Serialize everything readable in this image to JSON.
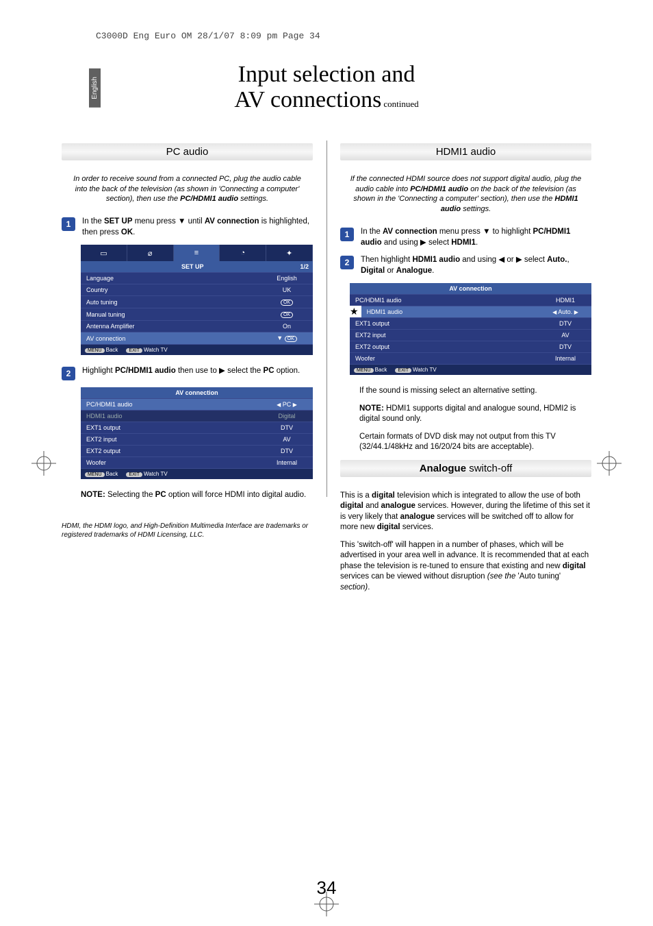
{
  "crop_header": "C3000D Eng Euro OM  28/1/07  8:09 pm  Page 34",
  "lang_tab": "English",
  "title_line1": "Input selection and",
  "title_line2": "AV connections",
  "title_suffix": "continued",
  "pc_audio": {
    "heading": "PC audio",
    "intro_html": "In order to receive sound from a connected PC, plug the audio cable into the back of the television (as shown in 'Connecting a computer' section), then use the <b>PC/HDMI1 audio</b> settings.",
    "step1_html": "In the <b>SET UP</b> menu press ▼ until <b>AV connection</b> is highlighted, then press <b>OK</b>.",
    "step2_html": "Highlight <b>PC/HDMI1 audio</b> then use to ▶ select the <b>PC</b> option.",
    "note_html": "<b>NOTE:</b> Selecting the <b>PC</b> option will force HDMI into digital audio."
  },
  "setup_osd": {
    "title": "SET UP",
    "page": "1/2",
    "rows": [
      {
        "label": "Language",
        "value": "English"
      },
      {
        "label": "Country",
        "value": "UK"
      },
      {
        "label": "Auto tuning",
        "value": "OK"
      },
      {
        "label": "Manual tuning",
        "value": "OK"
      },
      {
        "label": "Antenna Amplifier",
        "value": "On"
      },
      {
        "label": "AV connection",
        "value": "OK"
      }
    ],
    "footer_back": "Back",
    "footer_watch": "Watch TV",
    "menu_pill": "MENU",
    "exit_pill": "EXIT"
  },
  "av_osd_pc": {
    "title": "AV connection",
    "rows": [
      {
        "label": "PC/HDMI1 audio",
        "value": "PC",
        "hi": true,
        "arrows": true
      },
      {
        "label": "HDMI1 audio",
        "value": "Digital",
        "dim": true
      },
      {
        "label": "EXT1 output",
        "value": "DTV"
      },
      {
        "label": "EXT2 input",
        "value": "AV"
      },
      {
        "label": "EXT2 output",
        "value": "DTV"
      },
      {
        "label": "Woofer",
        "value": "Internal"
      }
    ],
    "footer_back": "Back",
    "footer_watch": "Watch TV",
    "menu_pill": "MENU",
    "exit_pill": "EXIT"
  },
  "hdmi_audio": {
    "heading": "HDMI1 audio",
    "intro_html": "If the connected HDMI source does not support digital audio, plug the audio cable into <b>PC/HDMI1 audio</b> on the back of the television (as shown in the 'Connecting a computer' section), then use the <b>HDMI1 audio</b> settings.",
    "step1_html": "In the <b>AV connection</b> menu press ▼ to highlight <b>PC/HDMI1 audio</b> and using ▶ select <b>HDMI1</b>.",
    "step2_html": "Then highlight <b>HDMI1 audio</b> and using ◀ or ▶ select <b>Auto.</b>, <b>Digital</b> or <b>Analogue</b>.",
    "note1": "If the sound is missing select an alternative setting.",
    "note2_html": "<b>NOTE:</b> HDMI1 supports digital and analogue sound, HDMI2 is digital sound only.",
    "note3": "Certain formats of DVD disk may not output from this TV (32/44.1/48kHz and 16/20/24 bits are acceptable)."
  },
  "av_osd_hdmi": {
    "title": "AV connection",
    "rows": [
      {
        "label": "PC/HDMI1 audio",
        "value": "HDMI1"
      },
      {
        "label": "HDMI1 audio",
        "value": "Auto.",
        "hi": true,
        "arrows": true,
        "star": true
      },
      {
        "label": "EXT1 output",
        "value": "DTV"
      },
      {
        "label": "EXT2 input",
        "value": "AV"
      },
      {
        "label": "EXT2 output",
        "value": "DTV"
      },
      {
        "label": "Woofer",
        "value": "Internal"
      }
    ],
    "footer_back": "Back",
    "footer_watch": "Watch TV",
    "menu_pill": "MENU",
    "exit_pill": "EXIT"
  },
  "analogue": {
    "heading_html": "<b>Analogue</b> switch-off",
    "p1_html": "This is a <b>digital</b> television which is integrated to allow the use of both <b>digital</b> and <b>analogue</b> services. However, during the lifetime of this set it is very likely that <b>analogue</b> services will be switched off to allow for more new <b>digital</b> services.",
    "p2_html": "This 'switch-off' will happen in a number of phases, which will be advertised in your area well in advance. It is recommended that at each phase the television is re-tuned to ensure that existing and new <b>digital</b> services can be viewed without disruption <i>(see the</i> 'Auto tuning' <i>section)</i>."
  },
  "footnote": "HDMI, the HDMI logo, and High-Definition Multimedia Interface are trademarks or registered trademarks of HDMI Licensing, LLC.",
  "page_number": "34"
}
